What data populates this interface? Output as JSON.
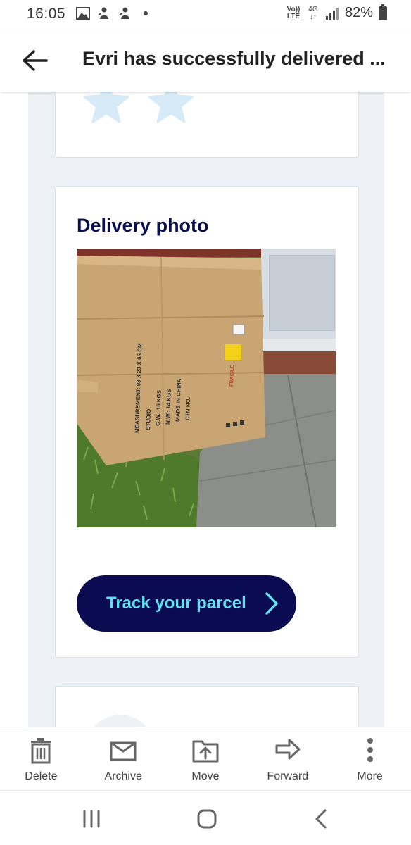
{
  "status_bar": {
    "time": "16:05",
    "volte_line1": "Vo))",
    "volte_line2": "LTE",
    "network_line1": "4G",
    "network_line2": "↓↑",
    "battery_percent": "82%",
    "icons": [
      "gallery-icon",
      "notification-icon",
      "notification-icon",
      "dot-icon",
      "signal-icon",
      "battery-icon"
    ]
  },
  "header": {
    "title": "Evri has successfully delivered ...",
    "back_icon": "arrow-left-icon"
  },
  "email": {
    "rating": {
      "stars_visible": 2,
      "star_color": "#d6eaf8"
    },
    "delivery_photo": {
      "title": "Delivery photo",
      "box_markings": {
        "measurement": "MEASUREMENT: 93 X 23 X 65 CM",
        "studio": "STUDIO",
        "gw": "G.W.: 15 KGS",
        "nw": "N.W.: 14 KGS",
        "origin": "MADE IN CHINA",
        "ctn": "CTN NO.",
        "fragile": "FRAGILE"
      }
    },
    "track_button": {
      "label": "Track your parcel",
      "icon": "chevron-right-icon"
    }
  },
  "toolbar": {
    "items": [
      {
        "label": "Delete",
        "icon": "trash-icon"
      },
      {
        "label": "Archive",
        "icon": "archive-icon"
      },
      {
        "label": "Move",
        "icon": "move-icon"
      },
      {
        "label": "Forward",
        "icon": "forward-arrow-icon"
      },
      {
        "label": "More",
        "icon": "more-vertical-icon"
      }
    ]
  },
  "nav": {
    "items": [
      "recent-apps-icon",
      "home-icon",
      "back-icon"
    ]
  },
  "colors": {
    "brand_navy": "#0b0b52",
    "button_text": "#5ee0ee",
    "title_navy": "#0a0f4d",
    "mail_background": "#eef1f5",
    "card_border": "#d6e2ee"
  }
}
